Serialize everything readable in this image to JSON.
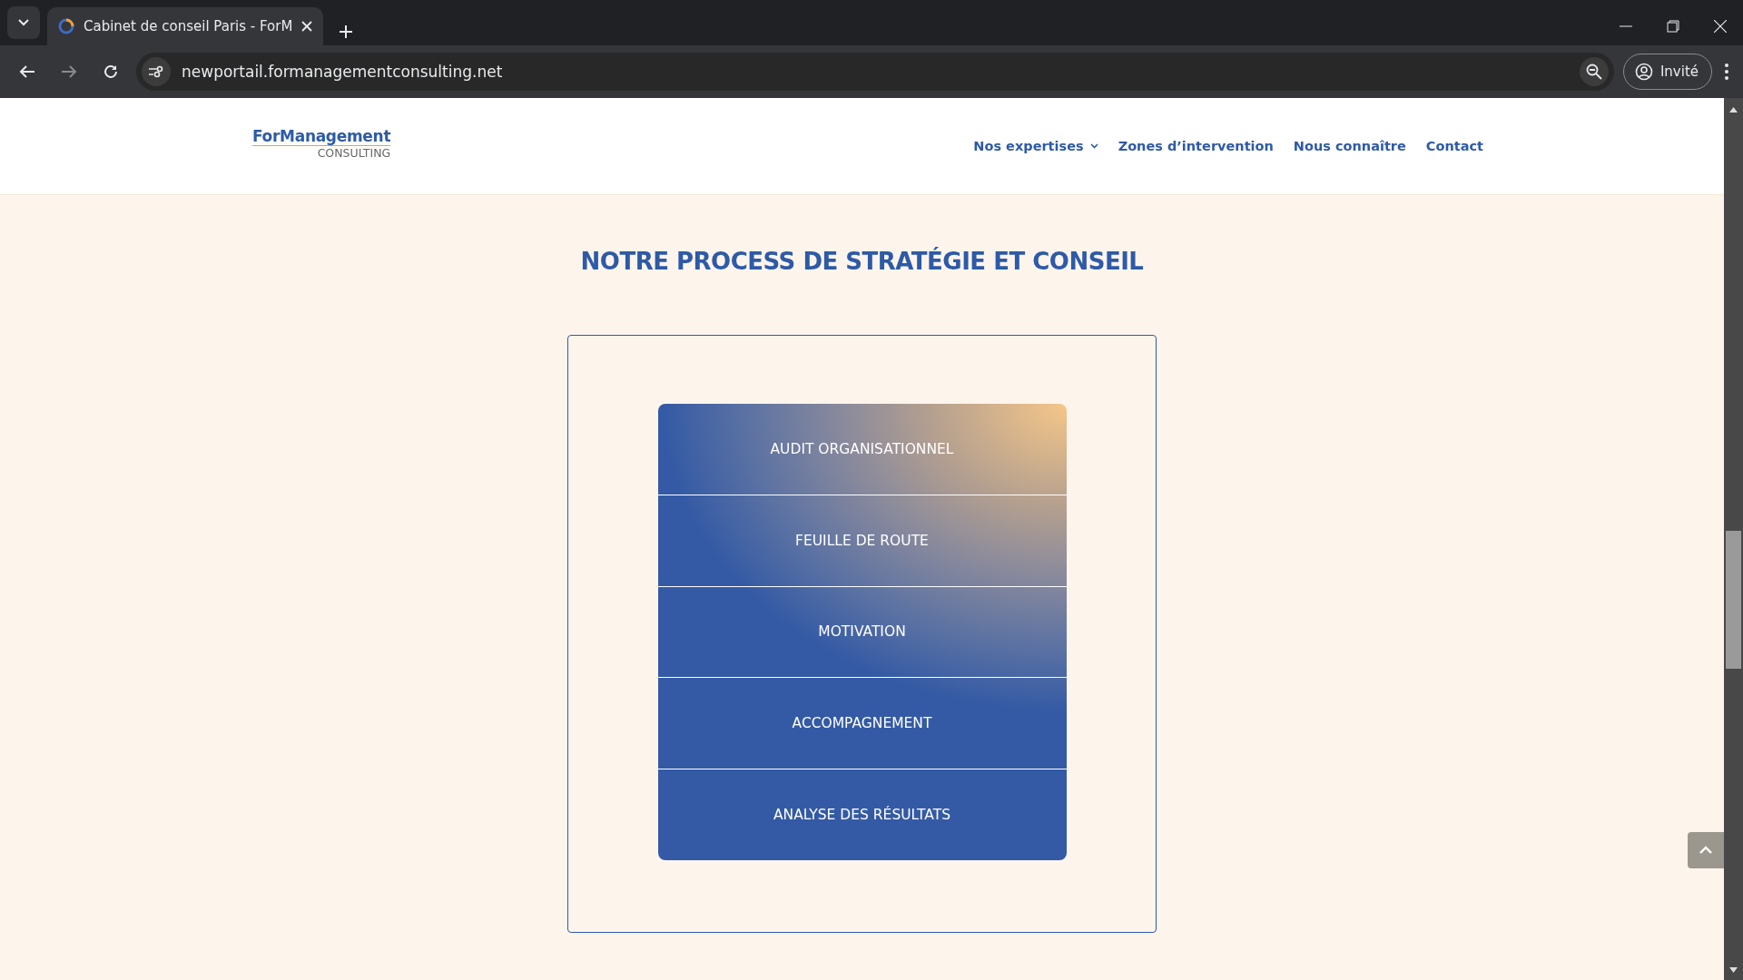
{
  "browser": {
    "tab_title": "Cabinet de conseil Paris - ForM",
    "url": "newportail.formanagementconsulting.net",
    "profile_label": "Invité"
  },
  "header": {
    "logo": {
      "name": "ForManagement",
      "tagline": "CONSULTING"
    },
    "nav": [
      {
        "label": "Nos expertises",
        "has_dropdown": true
      },
      {
        "label": "Zones d’intervention",
        "has_dropdown": false
      },
      {
        "label": "Nous connaître",
        "has_dropdown": false
      },
      {
        "label": "Contact",
        "has_dropdown": false
      }
    ]
  },
  "section": {
    "title": "NOTRE PROCESS DE STRATÉGIE ET CONSEIL",
    "steps": [
      "AUDIT ORGANISATIONNEL",
      "FEUILLE DE ROUTE",
      "MOTIVATION",
      "ACCOMPAGNEMENT",
      "ANALYSE DES RÉSULTATS"
    ]
  }
}
